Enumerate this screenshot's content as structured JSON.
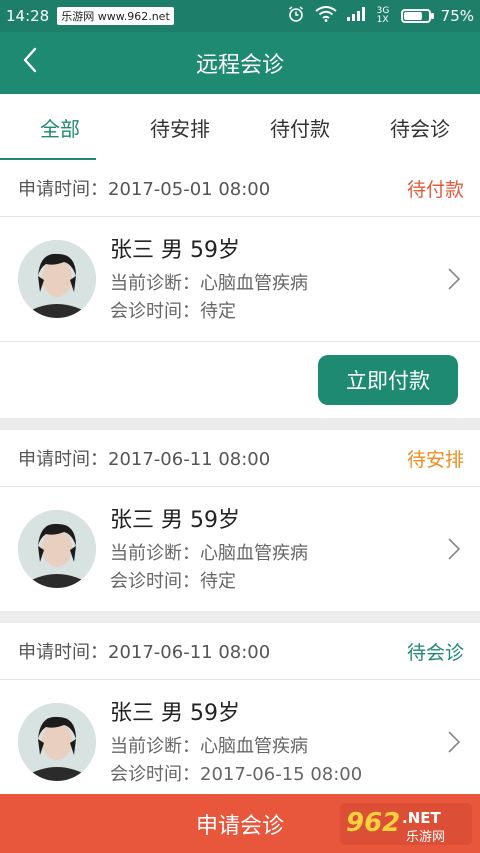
{
  "status_bar": {
    "time": "14:28",
    "watermark": "乐游网 www.962.net",
    "network": "3G 1X",
    "battery_percent": "75%",
    "battery_level": 0.75
  },
  "header": {
    "title": "远程会诊",
    "back_icon": "chevron-left-icon"
  },
  "tabs": [
    {
      "label": "全部",
      "active": true
    },
    {
      "label": "待安排",
      "active": false
    },
    {
      "label": "待付款",
      "active": false
    },
    {
      "label": "待会诊",
      "active": false
    }
  ],
  "cards": [
    {
      "apply_time": "申请时间：2017-05-01 08:00",
      "status": "待付款",
      "status_color": "#e25a3c",
      "patient": "张三 男 59岁",
      "diagnosis": "当前诊断：心脑血管疾病",
      "consult_time": "会诊时间：待定",
      "action_label": "立即付款"
    },
    {
      "apply_time": "申请时间：2017-06-11 08:00",
      "status": "待安排",
      "status_color": "#f08c1e",
      "patient": "张三 男 59岁",
      "diagnosis": "当前诊断：心脑血管疾病",
      "consult_time": "会诊时间：待定"
    },
    {
      "apply_time": "申请时间：2017-06-11 08:00",
      "status": "待会诊",
      "status_color": "#1e8a72",
      "patient": "张三 男 59岁",
      "diagnosis": "当前诊断：心脑血管疾病",
      "consult_time": "会诊时间：2017-06-15 08:00"
    }
  ],
  "bottom": {
    "apply_label": "申请会诊"
  },
  "logo": {
    "number": "962",
    "suffix": ".NET",
    "text": "乐游网"
  },
  "colors": {
    "primary": "#1e8a72",
    "bottom_bar": "#e8563c"
  }
}
